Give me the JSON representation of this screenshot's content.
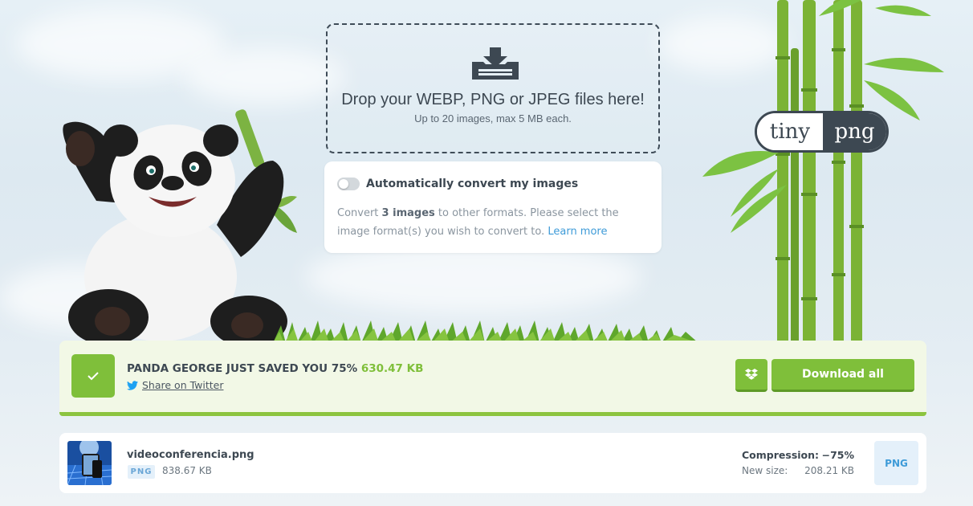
{
  "dropzone": {
    "icon": "download-tray-icon",
    "title": "Drop your WEBP, PNG or JPEG files here!",
    "subtitle": "Up to 20 images, max 5 MB each."
  },
  "convert": {
    "toggle_on": false,
    "title": "Automatically convert my images",
    "desc_prefix": "Convert ",
    "desc_count": "3 images",
    "desc_suffix": " to other formats. Please select the image format(s) you wish to convert to. ",
    "learn_more": "Learn more"
  },
  "logo": {
    "left": "tiny",
    "right": "png"
  },
  "summary": {
    "title": "PANDA GEORGE JUST SAVED YOU 75%",
    "saved": "630.47 KB",
    "share_label": "Share on Twitter",
    "download_all": "Download all",
    "colors": {
      "accent": "#7fbf3a",
      "twitter": "#1da1f2"
    }
  },
  "files": [
    {
      "name": "videoconferencia.png",
      "type": "PNG",
      "original_size": "838.67 KB",
      "compression_label": "Compression:",
      "compression_value": "−75%",
      "new_size_label": "New size:",
      "new_size_value": "208.21 KB",
      "format_button": "PNG"
    }
  ]
}
